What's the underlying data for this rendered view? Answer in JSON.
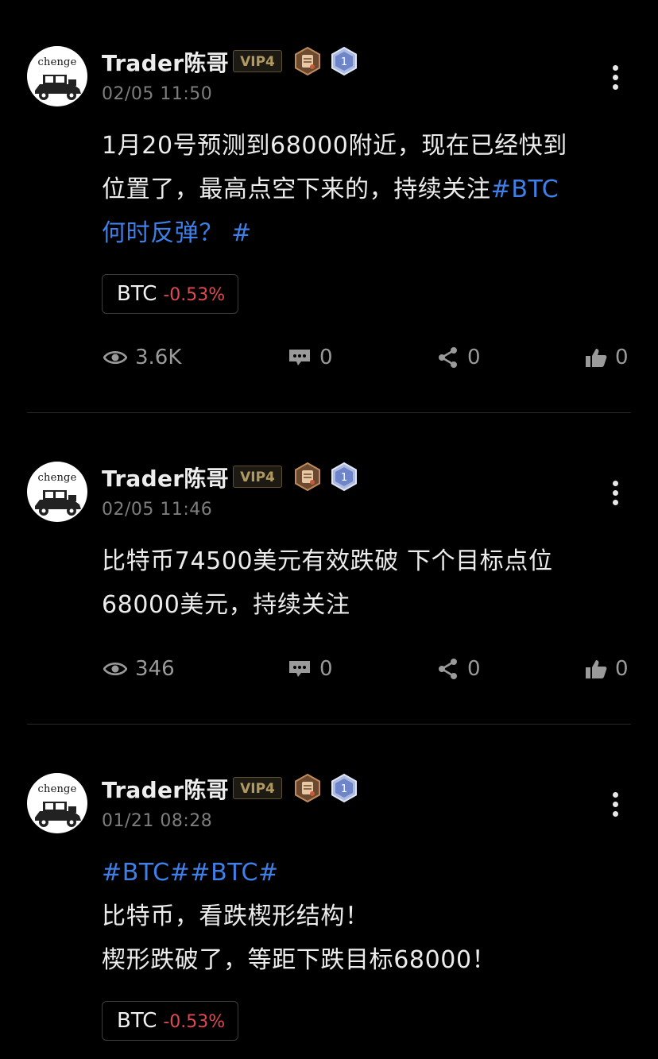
{
  "posts": [
    {
      "author": "Trader陈哥",
      "avatar_text": "chenge",
      "vip": "VIP4",
      "level": "1",
      "time": "02/05 11:50",
      "content": [
        [
          {
            "text": "1月20号预测到68000附近，现在已经快到"
          }
        ],
        [
          {
            "text": "位置了，最高点空下来的，持续关注"
          },
          {
            "text": "#BTC",
            "tag": true
          }
        ],
        [
          {
            "text": "何时反弹？ #",
            "tag": true
          }
        ]
      ],
      "ticker": {
        "symbol": "BTC",
        "change": "-0.53%"
      },
      "stats": {
        "views": "3.6K",
        "comments": "0",
        "shares": "0",
        "likes": "0"
      }
    },
    {
      "author": "Trader陈哥",
      "avatar_text": "chenge",
      "vip": "VIP4",
      "level": "1",
      "time": "02/05 11:46",
      "content": [
        [
          {
            "text": "比特币74500美元有效跌破 下个目标点位"
          }
        ],
        [
          {
            "text": "68000美元，持续关注"
          }
        ]
      ],
      "stats": {
        "views": "346",
        "comments": "0",
        "shares": "0",
        "likes": "0"
      }
    },
    {
      "author": "Trader陈哥",
      "avatar_text": "chenge",
      "vip": "VIP4",
      "level": "1",
      "time": "01/21 08:28",
      "content": [
        [
          {
            "text": "#BTC##BTC#",
            "tag": true
          }
        ],
        [
          {
            "text": "比特币，看跌楔形结构！"
          }
        ],
        [
          {
            "text": "楔形跌破了，等距下跌目标68000！"
          }
        ]
      ],
      "ticker": {
        "symbol": "BTC",
        "change": "-0.53%"
      }
    }
  ],
  "icons": {
    "views": "eye-icon",
    "comments": "comment-icon",
    "shares": "share-icon",
    "likes": "thumbs-up-icon",
    "more": "more-vertical-icon"
  },
  "colors": {
    "background": "#000000",
    "hashtag": "#3f7fe8",
    "negative_change": "#e04952",
    "vip_text": "#b09a62"
  }
}
